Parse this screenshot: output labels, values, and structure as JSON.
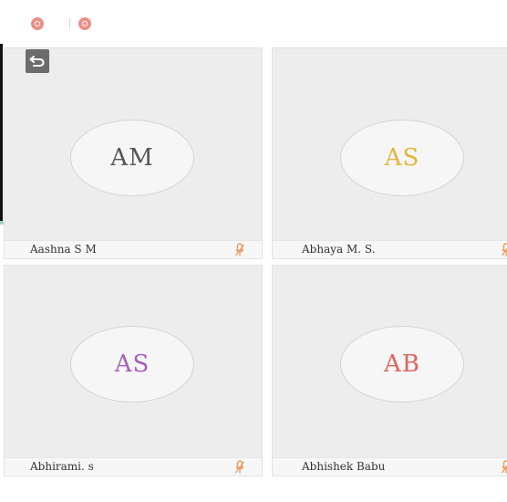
{
  "toolbar": {
    "icons": [
      "video-off-icon",
      "mic-off-icon"
    ],
    "accent_color": "#ec8f8a"
  },
  "back_button": {
    "icon": "undo-arrow-icon"
  },
  "participants": [
    {
      "initials": "AM",
      "name": "Aashna S M",
      "initials_color": "#555555",
      "muted": true,
      "mic_icon": "mic-muted-icon"
    },
    {
      "initials": "AS",
      "name": "Abhaya M. S.",
      "initials_color": "#e2b43b",
      "muted": true,
      "mic_icon": "mic-muted-icon"
    },
    {
      "initials": "AS",
      "name": "Abhirami. s",
      "initials_color": "#a860b8",
      "muted": true,
      "mic_icon": "mic-muted-icon"
    },
    {
      "initials": "AB",
      "name": "Abhishek Babu",
      "initials_color": "#e0645c",
      "muted": true,
      "mic_icon": "mic-muted-icon"
    }
  ],
  "colors": {
    "tile_background": "#ededed",
    "mic_muted": "#e89a5f"
  }
}
